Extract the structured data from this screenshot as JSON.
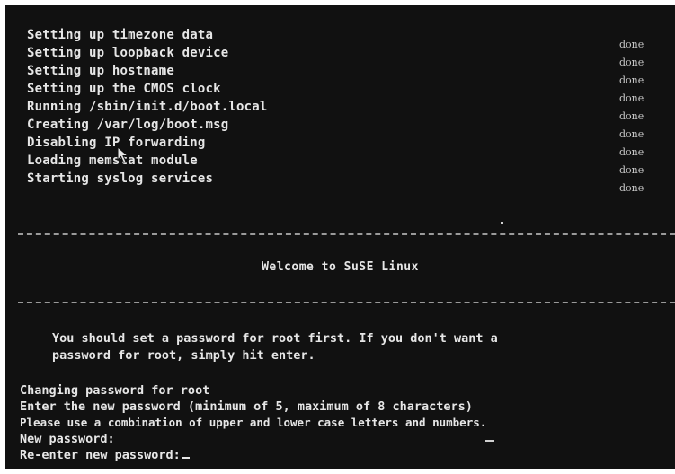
{
  "boot": {
    "lines": [
      "Setting up timezone data",
      "Setting up loopback device",
      "Setting up hostname",
      "Setting up the CMOS clock",
      "Running /sbin/init.d/boot.local",
      "Creating /var/log/boot.msg",
      "Disabling IP forwarding",
      "Loading memstat module",
      "Starting syslog services"
    ],
    "status": [
      "done",
      "done",
      "done",
      "done",
      "done",
      "done",
      "done",
      "done",
      "done"
    ]
  },
  "banner": {
    "welcome": "Welcome to SuSE Linux"
  },
  "notice": {
    "line1": "You should set a password for root first. If you don't want a",
    "line2": "password for root, simply hit enter."
  },
  "passwd": {
    "changing": "Changing password for root",
    "enter_new": "Enter the new password (minimum of 5, maximum of 8 characters)",
    "hint": "Please use a combination of upper and lower case letters and numbers.",
    "new_prompt": "New password:",
    "reenter_prompt": "Re-enter new password:"
  },
  "colors": {
    "background": "#111111",
    "text": "#e6e6e6",
    "status": "#c8c8c8",
    "separator": "#9a9a9a"
  },
  "icons": {
    "pointer": "mouse-pointer-icon"
  }
}
